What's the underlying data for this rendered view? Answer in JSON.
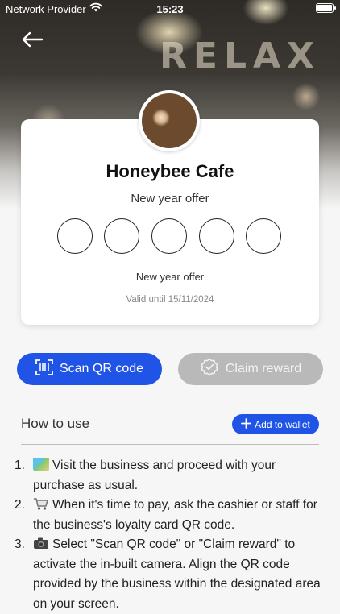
{
  "status_bar": {
    "carrier": "Network Provider",
    "time": "15:23"
  },
  "card": {
    "business_name": "Honeybee Cafe",
    "offer_title": "New year offer",
    "stamps_total": 5,
    "stamps_filled": 0,
    "offer_label": "New year offer",
    "valid_text": "Valid until 15/11/2024"
  },
  "hero": {
    "sign_text": "RELAX"
  },
  "actions": {
    "scan_label": "Scan QR code",
    "claim_label": "Claim reward"
  },
  "how_to_use": {
    "heading": "How to use",
    "wallet_label": "Add to wallet",
    "steps": [
      {
        "number": "1.",
        "text": "Visit the business and proceed with your purchase as usual."
      },
      {
        "number": "2.",
        "text": "When it's time to pay, ask the cashier or staff for the business's loyalty card QR code."
      },
      {
        "number": "3.",
        "text": "Select \"Scan QR code\" or \"Claim reward\" to activate the in-built camera. Align the QR code provided by the business within the designated area on your screen."
      }
    ]
  },
  "colors": {
    "primary": "#1f54e6",
    "disabled": "#b9b9b9",
    "background": "#f6f6f6"
  }
}
